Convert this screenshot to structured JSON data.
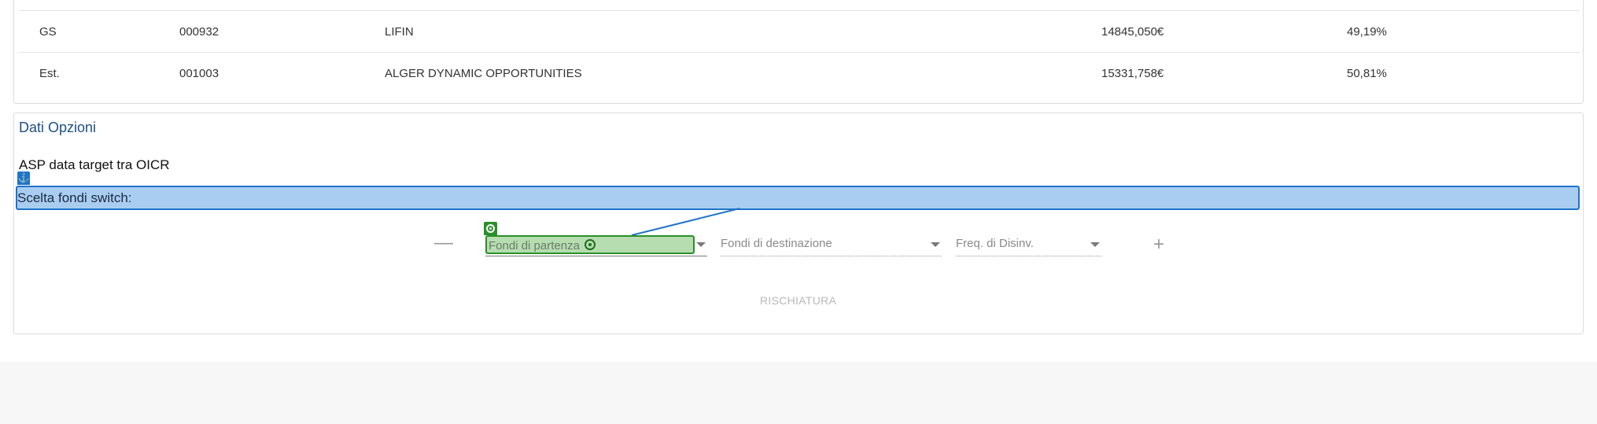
{
  "table": {
    "rows": [
      {
        "tipo": "GS",
        "codice": "000932",
        "nome": "LIFIN",
        "importo": "14845,050€",
        "percentuale": "49,19%"
      },
      {
        "tipo": "Est.",
        "codice": "001003",
        "nome": "ALGER DYNAMIC OPPORTUNITIES",
        "importo": "15331,758€",
        "percentuale": "50,81%"
      }
    ]
  },
  "options": {
    "title": "Dati Opzioni",
    "asp_label": "ASP data target tra OICR",
    "switch_label": "Scelta fondi switch:",
    "anchor_icon": "anchor-icon",
    "fields": {
      "from_placeholder": "Fondi di partenza",
      "to_placeholder": "Fondi di destinazione",
      "freq_placeholder": "Freq. di Disinv."
    },
    "remove_symbol": "—",
    "add_symbol": "+",
    "submit_label": "RISCHIATURA"
  },
  "colors": {
    "title_blue": "#1d4f86",
    "highlight_blue": "#a9cdf1",
    "highlight_green": "#b6ddb0",
    "footer_bg": "#f7f7f7"
  }
}
